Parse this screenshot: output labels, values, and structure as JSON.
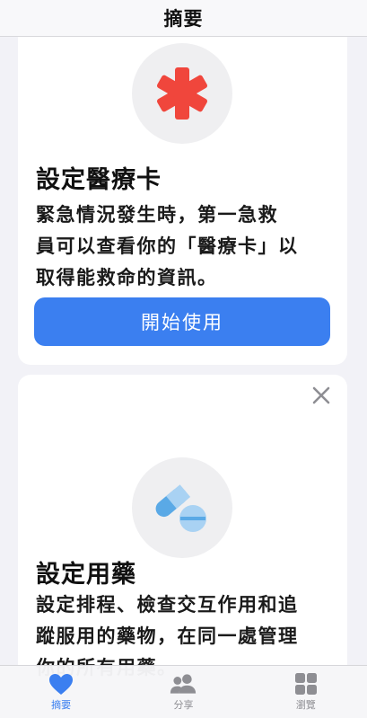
{
  "navbar": {
    "title": "摘要"
  },
  "medical_card": {
    "icon": "medical-asterisk-icon",
    "title": "設定醫療卡",
    "body_lines": [
      "緊急情況發生時，第一急救",
      "員可以查看你的「醫療卡」以",
      "取得能救命的資訊。"
    ],
    "button_label": "開始使用",
    "colors": {
      "icon": "#f0463c",
      "button": "#3b7ff0"
    }
  },
  "medications_card": {
    "icon": "pills-icon",
    "close_icon": "close-icon",
    "title": "設定用藥",
    "body_lines": [
      "設定排程、檢查交互作用和追",
      "蹤服用的藥物，在同一處管理",
      "你的所有用藥。"
    ],
    "colors": {
      "icon": "#5aa9e6"
    }
  },
  "tabbar": {
    "tabs": [
      {
        "label": "摘要",
        "icon": "heart-icon",
        "active": true
      },
      {
        "label": "分享",
        "icon": "people-icon",
        "active": false
      },
      {
        "label": "瀏覽",
        "icon": "grid-icon",
        "active": false
      }
    ],
    "colors": {
      "active": "#3b7ff0",
      "inactive": "#8e8e93"
    }
  }
}
